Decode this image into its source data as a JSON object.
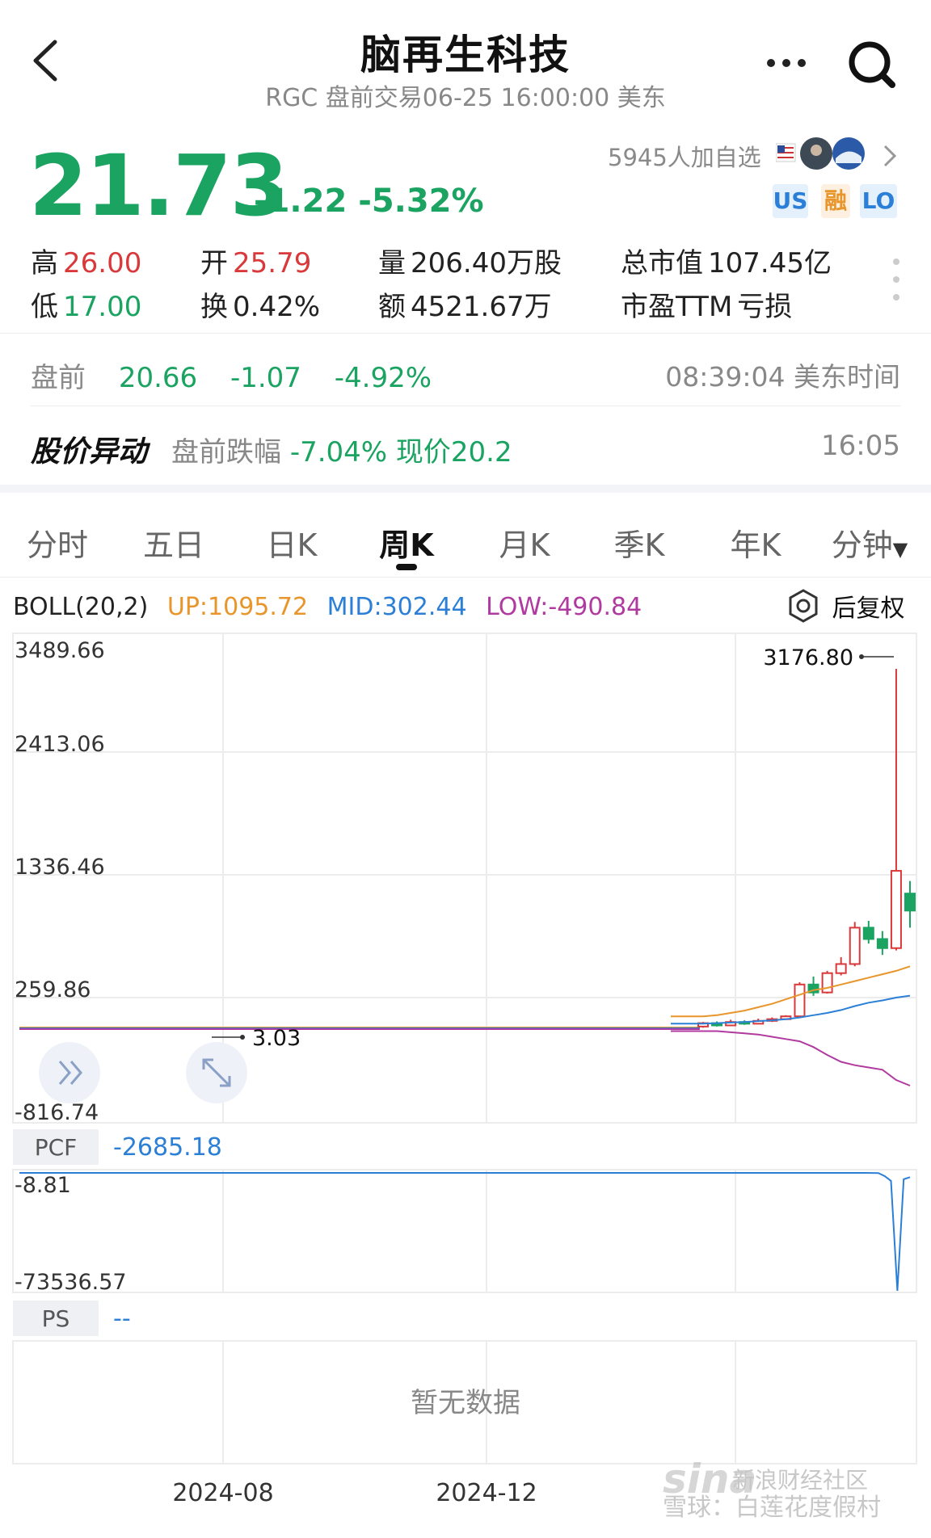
{
  "header": {
    "title": "脑再生科技",
    "subtitle": "RGC 盘前交易06-25 16:00:00 美东"
  },
  "quote": {
    "price": "21.73",
    "change": "-1.22 -5.32%",
    "watchers": "5945人加自选",
    "tags": [
      "US",
      "融",
      "LO"
    ]
  },
  "stats": [
    {
      "label": "高",
      "value": "26.00",
      "color": "#d9393b"
    },
    {
      "label": "开",
      "value": "25.79",
      "color": "#d9393b"
    },
    {
      "label": "量",
      "value": "206.40万股",
      "color": "#222222"
    },
    {
      "label": "总市值",
      "value": "107.45亿",
      "color": "#222222"
    },
    {
      "label": "低",
      "value": "17.00",
      "color": "#1aa361"
    },
    {
      "label": "换",
      "value": "0.42%",
      "color": "#222222"
    },
    {
      "label": "额",
      "value": "4521.67万",
      "color": "#222222"
    },
    {
      "label": "市盈TTM",
      "value": "亏损",
      "color": "#222222"
    }
  ],
  "premarket": {
    "label": "盘前",
    "price": "20.66",
    "change": "-1.07",
    "pct": "-4.92%",
    "time": "08:39:04 美东时间"
  },
  "alert": {
    "title": "股价异动",
    "prefix": "盘前跌幅",
    "text": "-7.04% 现价20.2",
    "time": "16:05"
  },
  "tabs": [
    "分时",
    "五日",
    "日K",
    "周K",
    "月K",
    "季K",
    "年K",
    "分钟"
  ],
  "active_tab": "周K",
  "indicator": {
    "name": "BOLL(20,2)",
    "up": "UP:1095.72",
    "mid": "MID:302.44",
    "low": "LOW:-490.84",
    "adjust": "后复权",
    "colors": {
      "up": "#e8952b",
      "mid": "#2b7fd6",
      "low": "#b03aa0"
    }
  },
  "chart_data": [
    {
      "type": "candlestick",
      "y_ticks": [
        "3489.66",
        "2413.06",
        "1336.46",
        "259.86",
        "-816.74"
      ],
      "ylim": [
        -816.74,
        3489.66
      ],
      "max_label": "3176.80",
      "min_label": "3.03",
      "x_ticks": [
        "2024-08",
        "2024-12"
      ],
      "candles": [
        {
          "o": 30,
          "c": 60,
          "h": 70,
          "l": 20
        },
        {
          "o": 60,
          "c": 40,
          "h": 75,
          "l": 30
        },
        {
          "o": 40,
          "c": 70,
          "h": 90,
          "l": 35
        },
        {
          "o": 70,
          "c": 55,
          "h": 85,
          "l": 45
        },
        {
          "o": 55,
          "c": 80,
          "h": 100,
          "l": 50
        },
        {
          "o": 80,
          "c": 95,
          "h": 110,
          "l": 70
        },
        {
          "o": 95,
          "c": 120,
          "h": 130,
          "l": 90
        },
        {
          "o": 120,
          "c": 400,
          "h": 420,
          "l": 110
        },
        {
          "o": 400,
          "c": 330,
          "h": 470,
          "l": 300
        },
        {
          "o": 330,
          "c": 500,
          "h": 520,
          "l": 320
        },
        {
          "o": 500,
          "c": 580,
          "h": 640,
          "l": 480
        },
        {
          "o": 580,
          "c": 900,
          "h": 950,
          "l": 560
        },
        {
          "o": 900,
          "c": 800,
          "h": 960,
          "l": 760
        },
        {
          "o": 800,
          "c": 720,
          "h": 870,
          "l": 660
        },
        {
          "o": 720,
          "c": 1400,
          "h": 3176.8,
          "l": 700
        },
        {
          "o": 1200,
          "c": 1050,
          "h": 1310,
          "l": 900
        }
      ],
      "series": [
        {
          "name": "UP",
          "values": [
            120,
            130,
            150,
            170,
            200,
            230,
            270,
            310,
            350,
            370,
            400,
            430,
            460,
            490,
            520,
            560
          ]
        },
        {
          "name": "MID",
          "values": [
            55,
            60,
            65,
            70,
            78,
            85,
            95,
            110,
            130,
            150,
            175,
            210,
            240,
            260,
            285,
            302
          ]
        },
        {
          "name": "LOW",
          "values": [
            -10,
            -10,
            -20,
            -30,
            -40,
            -60,
            -80,
            -100,
            -150,
            -220,
            -280,
            -310,
            -330,
            -350,
            -440,
            -490
          ]
        }
      ]
    },
    {
      "type": "line",
      "name": "PCF",
      "value": "-2685.18",
      "y_ticks": [
        "-8.81",
        "-73536.57"
      ],
      "ylim": [
        -73536.57,
        -8.81
      ],
      "values": [
        -8.81,
        -10,
        -12,
        -15,
        -20,
        -40,
        -120,
        -2000,
        -5000,
        -73536.57,
        -4000,
        -2685.18
      ]
    },
    {
      "type": "table",
      "name": "PS",
      "value": "--",
      "empty_text": "暂无数据"
    }
  ],
  "watermark": {
    "brand": "sina",
    "caption": "新浪财经社区",
    "author": "雪球：白莲花度假村"
  }
}
